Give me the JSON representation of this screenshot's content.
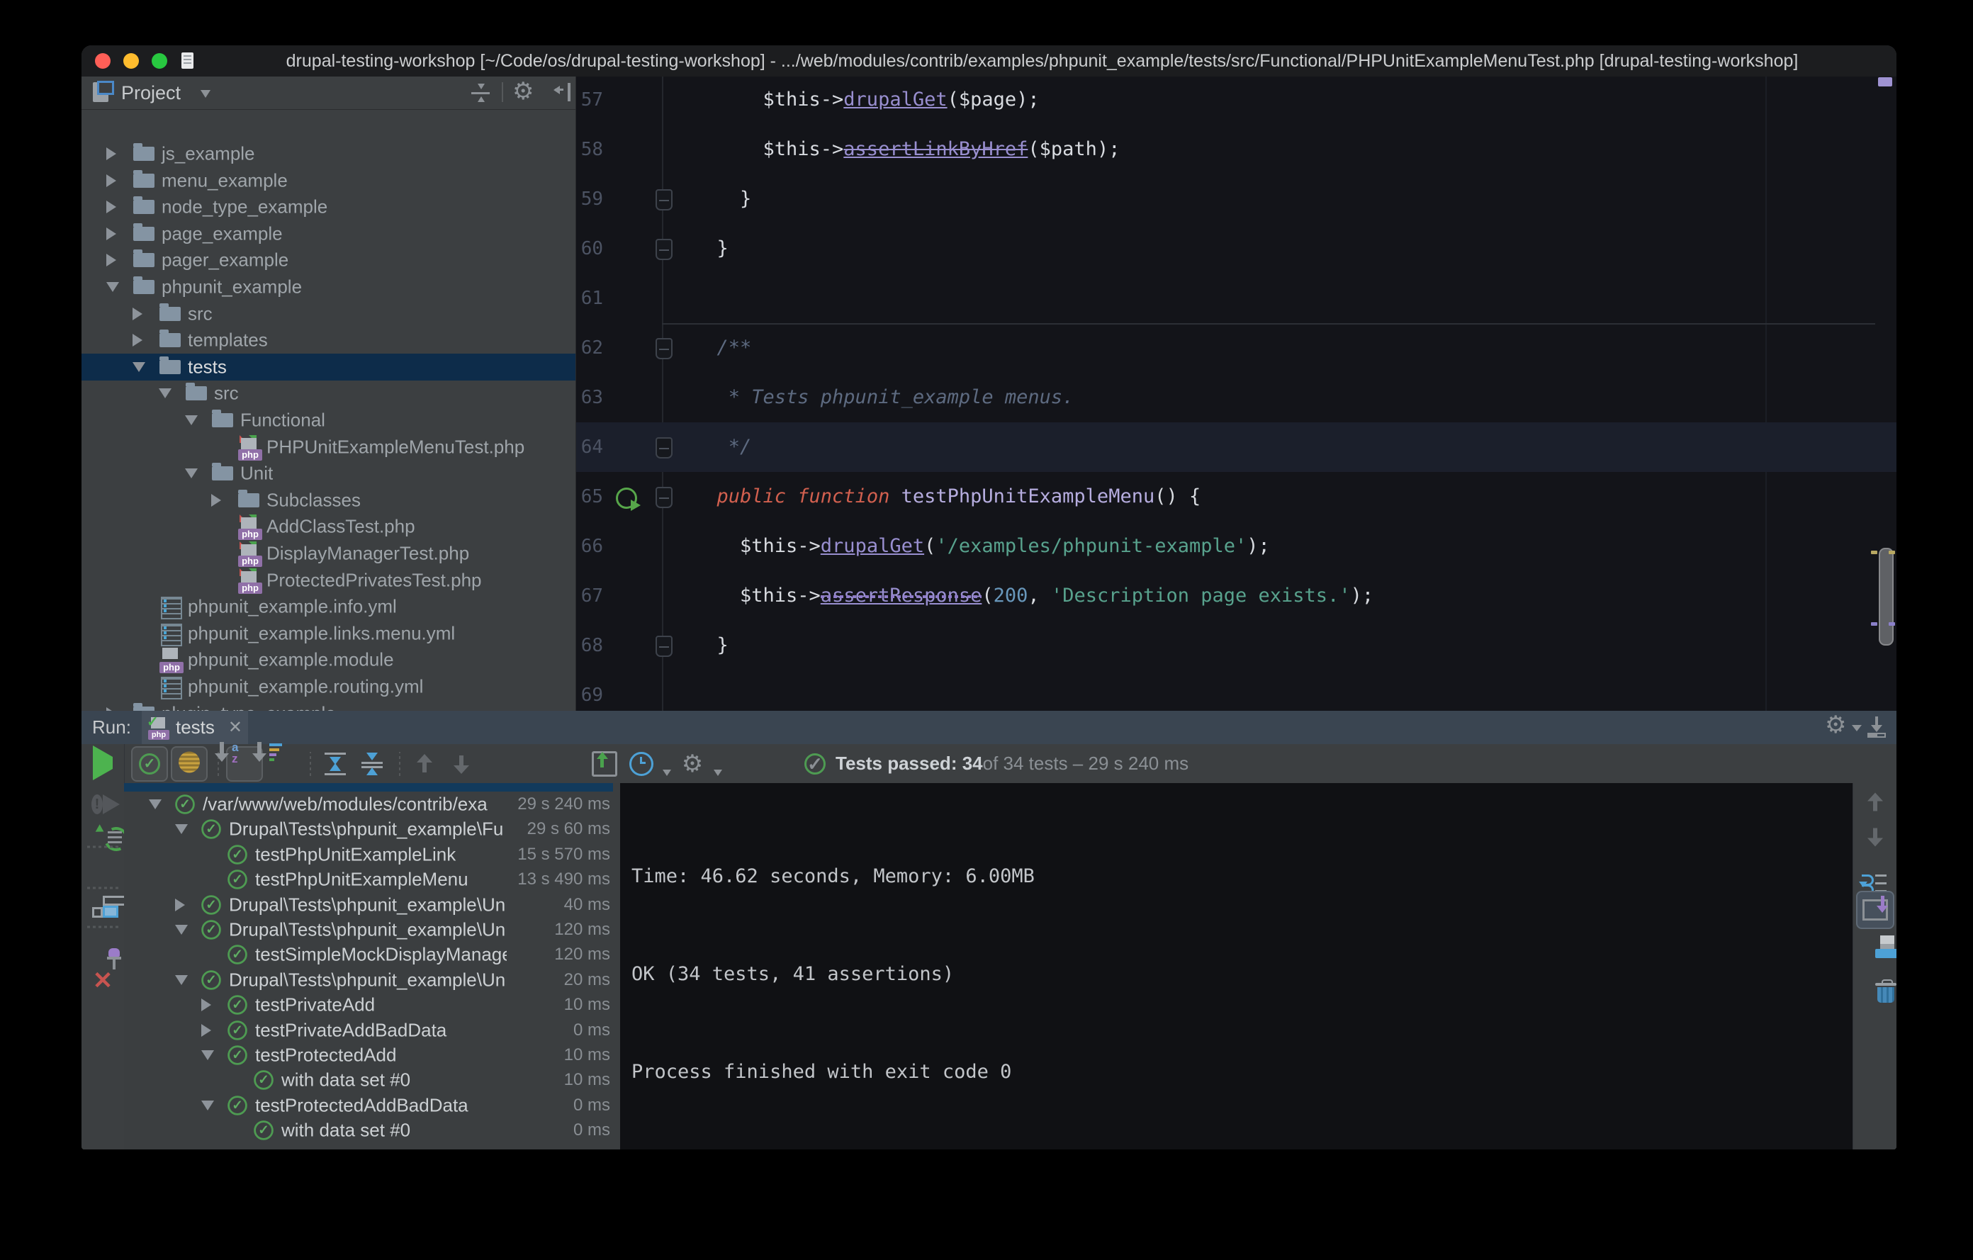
{
  "title_bar": {
    "title": "drupal-testing-workshop [~/Code/os/drupal-testing-workshop] - .../web/modules/contrib/examples/phpunit_example/tests/src/Functional/PHPUnitExampleMenuTest.php [drupal-testing-workshop]"
  },
  "colors": {
    "accent_blue": "#4da1d6",
    "pass_green": "#4e9b52",
    "selection_blue": "#0d2c4a",
    "keyword_red": "#d2604f",
    "method_purple": "#998fd0",
    "string_green": "#58a28d"
  },
  "project_panel": {
    "title": "Project",
    "tree": [
      {
        "label": "js_example",
        "depth": 0,
        "kind": "folder",
        "arrow": "right"
      },
      {
        "label": "menu_example",
        "depth": 0,
        "kind": "folder",
        "arrow": "right"
      },
      {
        "label": "node_type_example",
        "depth": 0,
        "kind": "folder",
        "arrow": "right"
      },
      {
        "label": "page_example",
        "depth": 0,
        "kind": "folder",
        "arrow": "right"
      },
      {
        "label": "pager_example",
        "depth": 0,
        "kind": "folder",
        "arrow": "right"
      },
      {
        "label": "phpunit_example",
        "depth": 0,
        "kind": "folder",
        "arrow": "down"
      },
      {
        "label": "src",
        "depth": 1,
        "kind": "folder",
        "arrow": "right"
      },
      {
        "label": "templates",
        "depth": 1,
        "kind": "folder",
        "arrow": "right"
      },
      {
        "label": "tests",
        "depth": 1,
        "kind": "folder",
        "arrow": "down",
        "selected": true
      },
      {
        "label": "src",
        "depth": 2,
        "kind": "folder",
        "arrow": "down"
      },
      {
        "label": "Functional",
        "depth": 3,
        "kind": "folder",
        "arrow": "down"
      },
      {
        "label": "PHPUnitExampleMenuTest.php",
        "depth": 4,
        "kind": "php-test"
      },
      {
        "label": "Unit",
        "depth": 3,
        "kind": "folder",
        "arrow": "down"
      },
      {
        "label": "Subclasses",
        "depth": 4,
        "kind": "folder",
        "arrow": "right"
      },
      {
        "label": "AddClassTest.php",
        "depth": 4,
        "kind": "php-test"
      },
      {
        "label": "DisplayManagerTest.php",
        "depth": 4,
        "kind": "php-test"
      },
      {
        "label": "ProtectedPrivatesTest.php",
        "depth": 4,
        "kind": "php-test"
      },
      {
        "label": "phpunit_example.info.yml",
        "depth": 1,
        "kind": "yml"
      },
      {
        "label": "phpunit_example.links.menu.yml",
        "depth": 1,
        "kind": "yml"
      },
      {
        "label": "phpunit_example.module",
        "depth": 1,
        "kind": "php"
      },
      {
        "label": "phpunit_example.routing.yml",
        "depth": 1,
        "kind": "yml"
      },
      {
        "label": "plugin_type_example",
        "depth": 0,
        "kind": "folder",
        "arrow": "right"
      }
    ]
  },
  "editor": {
    "lines": [
      {
        "n": 57,
        "ind": 6,
        "t": [
          [
            "$this->",
            "p"
          ],
          [
            "drupalGet",
            "m"
          ],
          [
            "(",
            "p"
          ],
          [
            "$page",
            "p"
          ],
          [
            ");",
            "p"
          ]
        ]
      },
      {
        "n": 58,
        "ind": 6,
        "t": [
          [
            "$this->",
            "p"
          ],
          [
            "assertLinkByHref",
            "ms"
          ],
          [
            "(",
            "p"
          ],
          [
            "$path",
            "p"
          ],
          [
            ");",
            "p"
          ]
        ]
      },
      {
        "n": 59,
        "ind": 4,
        "t": [
          [
            "}",
            "p"
          ]
        ],
        "fold": true
      },
      {
        "n": 60,
        "ind": 2,
        "t": [
          [
            "}",
            "p"
          ]
        ],
        "fold": true
      },
      {
        "n": 61,
        "ind": 0,
        "t": []
      },
      {
        "n": 62,
        "ind": 2,
        "t": [
          [
            "/**",
            "c"
          ]
        ],
        "fold": true,
        "sep_above": true
      },
      {
        "n": 63,
        "ind": 3,
        "t": [
          [
            "* Tests phpunit_example menus.",
            "c"
          ]
        ]
      },
      {
        "n": 64,
        "ind": 3,
        "t": [
          [
            "*/",
            "c"
          ]
        ],
        "fold": true,
        "current": true
      },
      {
        "n": 65,
        "ind": 2,
        "t": [
          [
            "public function ",
            "kw"
          ],
          [
            "testPhpUnitExampleMenu",
            "decl"
          ],
          [
            "() {",
            "p"
          ]
        ],
        "fold": true,
        "run": true
      },
      {
        "n": 66,
        "ind": 4,
        "t": [
          [
            "$this->",
            "p"
          ],
          [
            "drupalGet",
            "m"
          ],
          [
            "(",
            "p"
          ],
          [
            "'/examples/phpunit-example'",
            "str"
          ],
          [
            ");",
            "p"
          ]
        ]
      },
      {
        "n": 67,
        "ind": 4,
        "t": [
          [
            "$this->",
            "p"
          ],
          [
            "assertResponse",
            "mw"
          ],
          [
            "(",
            "p"
          ],
          [
            "200",
            "num"
          ],
          [
            ", ",
            "p"
          ],
          [
            "'Description page exists.'",
            "str"
          ],
          [
            ");",
            "p"
          ]
        ]
      },
      {
        "n": 68,
        "ind": 2,
        "t": [
          [
            "}",
            "p"
          ]
        ],
        "fold": true
      },
      {
        "n": 69,
        "ind": 0,
        "t": []
      }
    ]
  },
  "run_panel": {
    "label": "Run:",
    "tab_label": "tests",
    "status": {
      "strong": "Tests passed: 34",
      "rest": " of 34 tests – 29 s 240 ms"
    },
    "toolbar_items": [
      {
        "icon": "show-passed",
        "pressed": true
      },
      {
        "icon": "show-ignored",
        "pressed": true
      },
      {
        "sep": true
      },
      {
        "icon": "sort-alpha",
        "pressed": true
      },
      {
        "icon": "sort-duration"
      },
      {
        "sep": true
      },
      {
        "icon": "expand-all"
      },
      {
        "icon": "collapse-all"
      },
      {
        "sep": true
      },
      {
        "icon": "arrow-up",
        "disabled": true
      },
      {
        "icon": "arrow-down",
        "disabled": true
      },
      {
        "icon": "import-tests",
        "gap": true
      },
      {
        "icon": "test-history",
        "caret": true
      },
      {
        "icon": "settings-gear",
        "caret": true
      }
    ],
    "left_toolbar": [
      "rerun",
      "rerun-failed",
      "auto-test",
      "sep",
      "stop",
      "sep",
      "restore-layout",
      "sep",
      "pin",
      "close"
    ],
    "right_toolbar": [
      "arrow-up",
      "arrow-down",
      "soft-wrap",
      "scroll-end",
      "print",
      "clear"
    ],
    "test_tree": [
      {
        "label": "/var/www/web/modules/contrib/exa",
        "dur": "29 s 240 ms",
        "depth": 0,
        "arrow": "down"
      },
      {
        "label": "Drupal\\Tests\\phpunit_example\\Fu",
        "dur": "29 s 60 ms",
        "depth": 1,
        "arrow": "down"
      },
      {
        "label": "testPhpUnitExampleLink",
        "dur": "15 s 570 ms",
        "depth": 2
      },
      {
        "label": "testPhpUnitExampleMenu",
        "dur": "13 s 490 ms",
        "depth": 2
      },
      {
        "label": "Drupal\\Tests\\phpunit_example\\Unit\\A",
        "dur": "40 ms",
        "depth": 1,
        "arrow": "right"
      },
      {
        "label": "Drupal\\Tests\\phpunit_example\\Unit\\D",
        "dur": "120 ms",
        "depth": 1,
        "arrow": "down"
      },
      {
        "label": "testSimpleMockDisplayManager",
        "dur": "120 ms",
        "depth": 2
      },
      {
        "label": "Drupal\\Tests\\phpunit_example\\Unit\\P",
        "dur": "20 ms",
        "depth": 1,
        "arrow": "down"
      },
      {
        "label": "testPrivateAdd",
        "dur": "10 ms",
        "depth": 2,
        "arrow": "right"
      },
      {
        "label": "testPrivateAddBadData",
        "dur": "0 ms",
        "depth": 2,
        "arrow": "right"
      },
      {
        "label": "testProtectedAdd",
        "dur": "10 ms",
        "depth": 2,
        "arrow": "down"
      },
      {
        "label": "with data set #0",
        "dur": "10 ms",
        "depth": 3
      },
      {
        "label": "testProtectedAddBadData",
        "dur": "0 ms",
        "depth": 2,
        "arrow": "down"
      },
      {
        "label": "with data set #0",
        "dur": "0 ms",
        "depth": 3
      }
    ],
    "console": [
      "Time: 46.62 seconds, Memory: 6.00MB",
      "OK (34 tests, 41 assertions)",
      "Process finished with exit code 0"
    ]
  }
}
